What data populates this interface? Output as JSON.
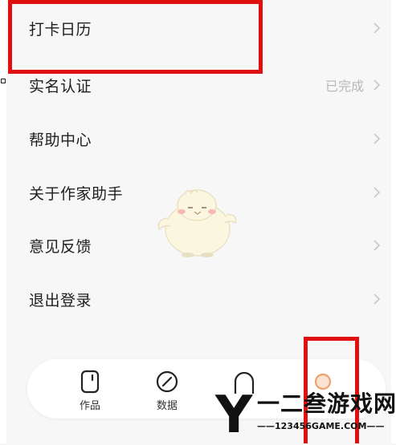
{
  "menu": {
    "items": [
      {
        "label": "打卡日历",
        "status": ""
      },
      {
        "label": "实名认证",
        "status": "已完成"
      },
      {
        "label": "帮助中心",
        "status": ""
      },
      {
        "label": "关于作家助手",
        "status": ""
      },
      {
        "label": "意见反馈",
        "status": ""
      },
      {
        "label": "退出登录",
        "status": ""
      }
    ]
  },
  "tabbar": {
    "tabs": [
      {
        "label": "作品",
        "icon": "works-icon"
      },
      {
        "label": "数据",
        "icon": "data-icon"
      },
      {
        "label": "",
        "icon": "community-icon"
      },
      {
        "label": "",
        "icon": "profile-icon"
      }
    ]
  },
  "watermark": {
    "letter": "Y",
    "brand": "一二叁游戏网",
    "url": "——123456GAME.COM——"
  },
  "colors": {
    "background": "#f7f7f7",
    "highlight": "#e01010",
    "status_text": "#b8b8b8",
    "active_tab": "#f0a070"
  }
}
